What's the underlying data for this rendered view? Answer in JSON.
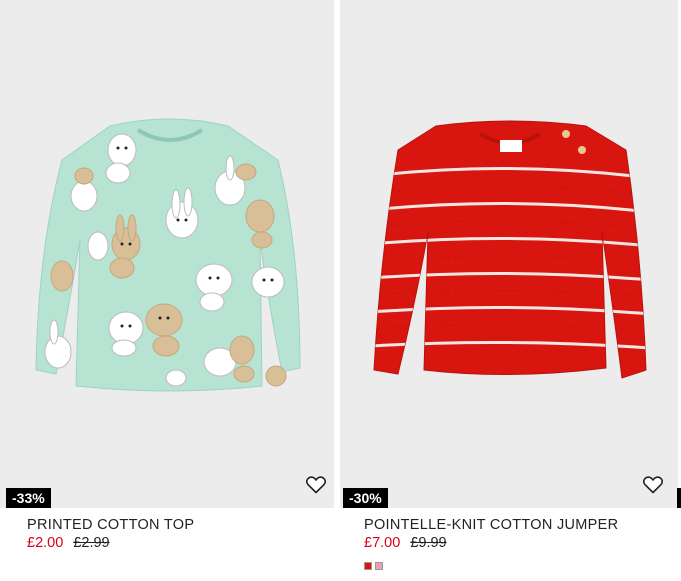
{
  "products": [
    {
      "name": "PRINTED COTTON TOP",
      "discount": "-33%",
      "price_now": "£2.00",
      "price_old": "£2.99",
      "favourite_icon": "heart-outline-icon",
      "image_color": "#b6e3d4"
    },
    {
      "name": "POINTELLE-KNIT COTTON JUMPER",
      "discount": "-30%",
      "price_now": "£7.00",
      "price_old": "£9.99",
      "favourite_icon": "heart-outline-icon",
      "image_color": "#d8160f",
      "swatch_colors": [
        "#d8160f",
        "#e9a3b4"
      ]
    }
  ],
  "colors": {
    "sale_price": "#d6001c",
    "badge_bg": "#000000",
    "image_bg": "#ececec"
  }
}
